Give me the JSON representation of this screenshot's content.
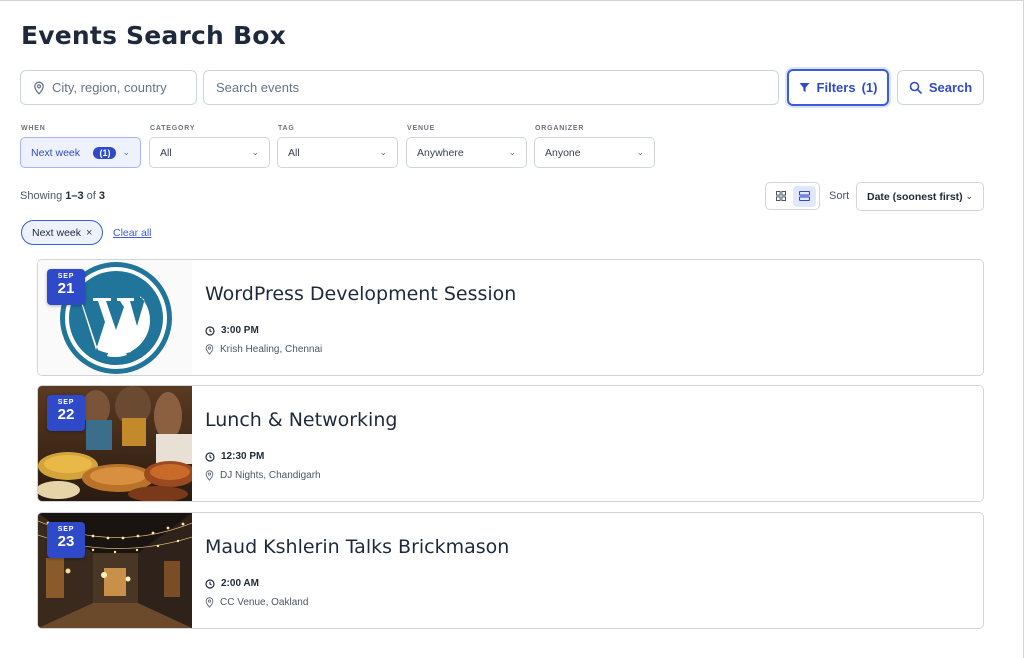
{
  "page": {
    "title": "Events Search Box"
  },
  "search": {
    "location_placeholder": "City, region, country",
    "events_placeholder": "Search events",
    "filters_label": "Filters",
    "filters_count": "(1)",
    "search_label": "Search"
  },
  "filters": [
    {
      "label": "WHEN",
      "value": "Next week",
      "badge": "(1)",
      "active": true
    },
    {
      "label": "CATEGORY",
      "value": "All"
    },
    {
      "label": "TAG",
      "value": "All"
    },
    {
      "label": "VENUE",
      "value": "Anywhere"
    },
    {
      "label": "ORGANIZER",
      "value": "Anyone"
    }
  ],
  "results": {
    "showing_prefix": "Showing ",
    "range": "1–3",
    "of_text": " of ",
    "total": "3",
    "sort_label": "Sort",
    "sort_value": "Date (soonest first)"
  },
  "active_filters": {
    "chip_label": "Next week",
    "chip_remove": "×",
    "clear_all": "Clear all"
  },
  "events": [
    {
      "month": "SEP",
      "day": "21",
      "title": "WordPress Development Session",
      "time": "3:00 PM",
      "venue": "Krish Healing, Chennai"
    },
    {
      "month": "SEP",
      "day": "22",
      "title": "Lunch & Networking",
      "time": "12:30 PM",
      "venue": "DJ Nights, Chandigarh"
    },
    {
      "month": "SEP",
      "day": "23",
      "title": "Maud Kshlerin Talks Brickmason",
      "time": "2:00 AM",
      "venue": "CC Venue, Oakland"
    }
  ],
  "colors": {
    "accent": "#2f4ac8",
    "wordpress_blue": "#21759b",
    "border": "#d1d5db"
  },
  "icons": {
    "location": "map-pin-icon",
    "filter": "funnel-icon",
    "search": "magnifier-icon",
    "grid_view": "grid-icon",
    "list_view": "list-icon",
    "time": "clock-icon",
    "venue": "map-pin-icon"
  }
}
